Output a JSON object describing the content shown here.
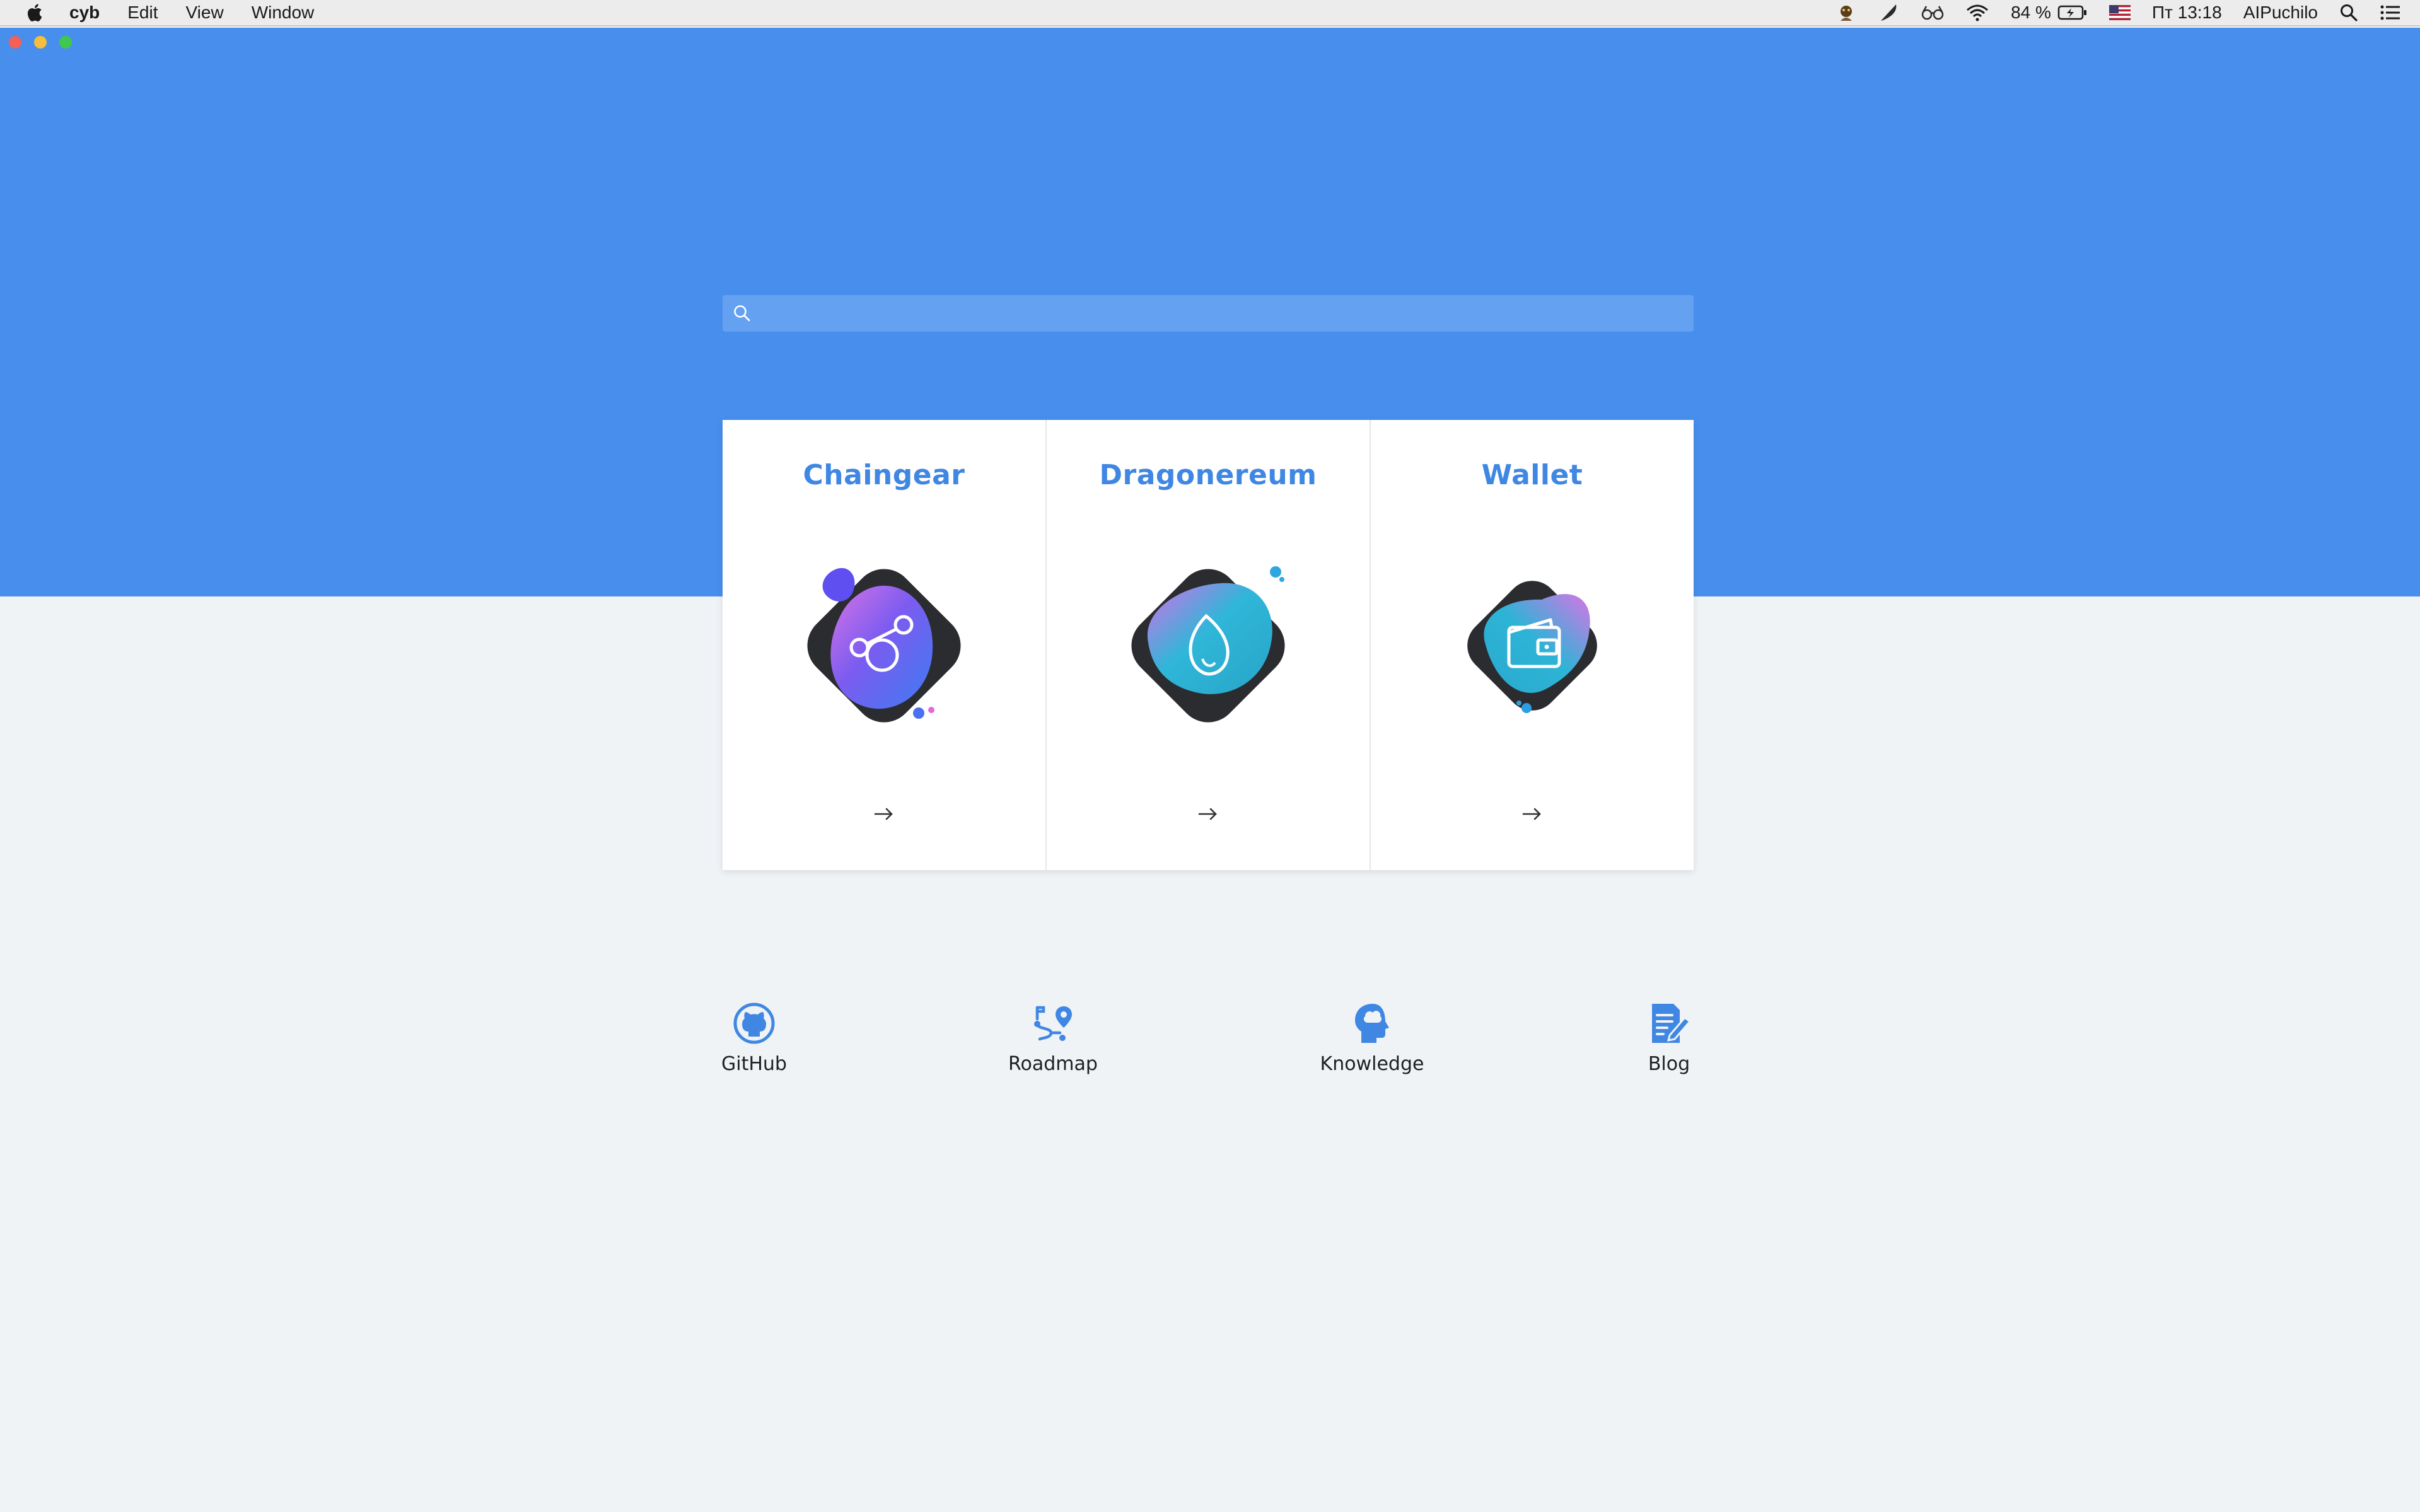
{
  "menubar": {
    "app_name": "cyb",
    "menus": [
      "Edit",
      "View",
      "Window"
    ],
    "battery": "84 %",
    "clock": "Пт 13:18",
    "user": "AIPuchilo"
  },
  "search": {
    "placeholder": ""
  },
  "cards": [
    {
      "title": "Chaingear",
      "icon": "chaingear-icon"
    },
    {
      "title": "Dragonereum",
      "icon": "dragon-egg-icon"
    },
    {
      "title": "Wallet",
      "icon": "wallet-icon"
    }
  ],
  "links": [
    {
      "label": "GitHub",
      "icon": "github-icon"
    },
    {
      "label": "Roadmap",
      "icon": "roadmap-icon"
    },
    {
      "label": "Knowledge",
      "icon": "knowledge-head-icon"
    },
    {
      "label": "Blog",
      "icon": "blog-icon"
    }
  ],
  "colors": {
    "header": "#488eec",
    "background": "#eff3f6",
    "accent": "#3f87e3",
    "search_bg": "#64a1f1"
  }
}
